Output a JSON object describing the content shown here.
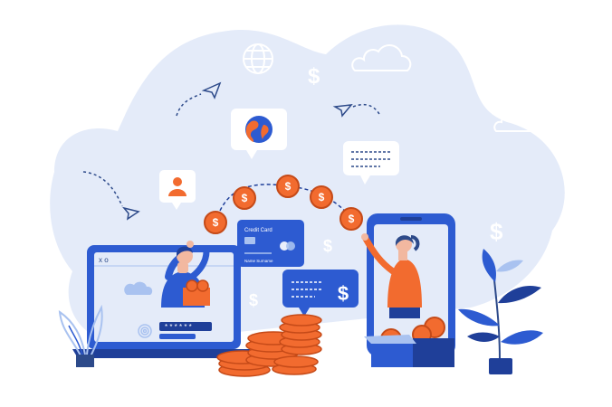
{
  "illustration": {
    "credit_card": {
      "title": "Credit Card",
      "name": "Name Surname"
    },
    "laptop": {
      "window_controls": "x o",
      "password_mask": "* * * * * *"
    },
    "coin_symbol": "$",
    "colors": {
      "background_blob": "#e4ebf9",
      "primary_blue": "#2d5bd1",
      "dark_blue": "#1f3f99",
      "orange": "#f26b2f",
      "light_blue": "#a9c2f0",
      "skin": "#f2b8a0"
    },
    "icons": [
      "globe-icon",
      "dollar-icon",
      "paper-plane-icon",
      "cloud-icon",
      "user-icon",
      "chat-bubble-icon",
      "fingerprint-icon",
      "plant-icon"
    ]
  }
}
